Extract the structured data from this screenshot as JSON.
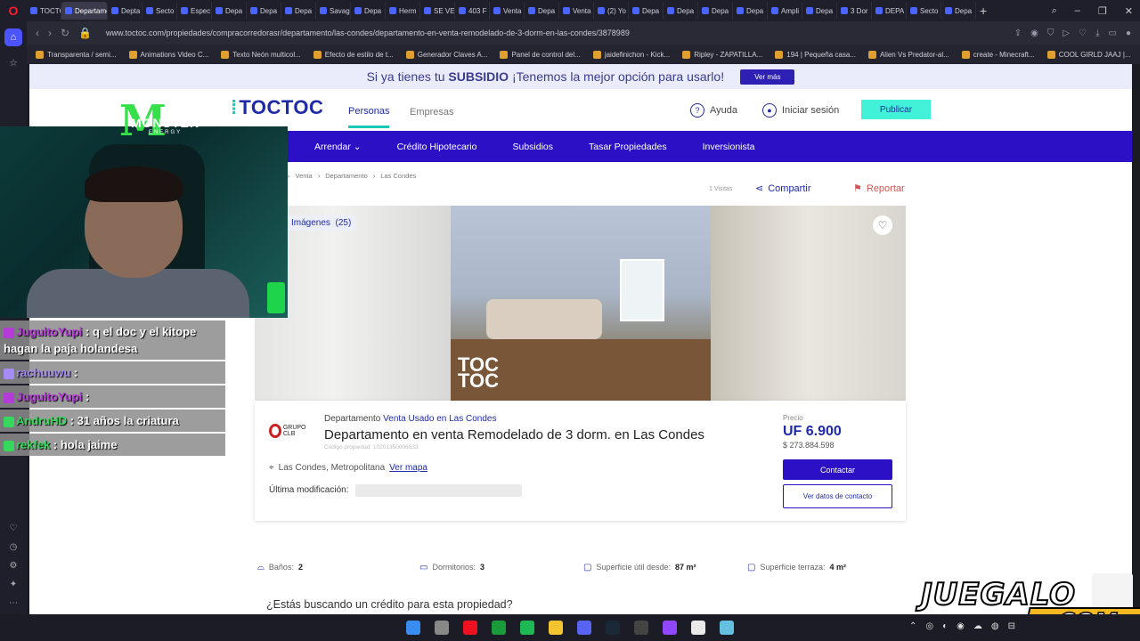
{
  "browser": {
    "tabs": [
      "TOCTC",
      "Departame",
      "Depta",
      "Secto",
      "Espec",
      "Depa",
      "Depa",
      "Depa",
      "Savag",
      "Depa",
      "Herm",
      "SE VE",
      "403 F",
      "Venta",
      "Depa",
      "Venta",
      "(2) Yo",
      "Depa",
      "Depa",
      "Depa",
      "Depa",
      "Ampli",
      "Depa",
      "3 Dor",
      "DEPA",
      "Secto",
      "Depa"
    ],
    "active_tab_index": 1,
    "url": "www.toctoc.com/propiedades/compracorredorasr/departamento/las-condes/departamento-en-venta-remodelado-de-3-dorm-en-las-condes/3878989",
    "bookmarks": [
      "Transparenta / semi...",
      "Animations Video C...",
      "Texto Neón multicol...",
      "Efecto de estilo de t...",
      "Generador Claves A...",
      "Panel de control del...",
      "jaidefinichon - Kick...",
      "Ripley - ZAPATILLA...",
      "194 | Pequeña casa...",
      "Alien Vs Predator-al...",
      "create - Minecraft...",
      "COOL GIRLD JAAJ |..."
    ]
  },
  "banner": {
    "text_before": "Si ya tienes tu",
    "text_bold": "SUBSIDIO",
    "text_after": "¡Tenemos la mejor opción para usarlo!",
    "button": "Ver más"
  },
  "header": {
    "logo_text": "TOCTOC",
    "nav_personas": "Personas",
    "nav_empresas": "Empresas",
    "ayuda": "Ayuda",
    "login": "Iniciar sesión",
    "publicar": "Publicar"
  },
  "menu": [
    "Arrendar",
    "Crédito Hipotecario",
    "Subsidios",
    "Tasar Propiedades",
    "Inversionista"
  ],
  "breadcrumb": [
    "Venta",
    "Departamento",
    "Las Condes"
  ],
  "actions": {
    "visitas": "1 Visitas",
    "compartir": "Compartir",
    "reportar": "Reportar"
  },
  "gallery": {
    "badge": "Imágenes",
    "count": "(25)",
    "watermark_1": "TOC",
    "watermark_2": "TOC"
  },
  "listing": {
    "agency": "GRUPO CLB",
    "type_prefix": "Departamento",
    "type_link": "Venta Usado en Las Condes",
    "title": "Departamento en venta Remodelado de 3 dorm. en Las Condes",
    "code": "Código propiedad: 10201350006533",
    "location": "Las Condes, Metropolitana",
    "map_link": "Ver mapa",
    "last_modified_label": "Última modificación:",
    "price_label": "Precio",
    "price_uf": "UF 6.900",
    "price_clp": "$ 273.884.598",
    "contact_button": "Contactar",
    "contact_data_button": "Ver datos de contacto"
  },
  "features": [
    {
      "label": "Baños:",
      "value": "2"
    },
    {
      "label": "Dormitorios:",
      "value": "3"
    },
    {
      "label": "Superficie útil desde:",
      "value": "87 m²"
    },
    {
      "label": "Superficie terraza:",
      "value": "4 m²"
    }
  ],
  "credit_question": "¿Estás buscando un crédito para esta propiedad?",
  "stream": {
    "chat": [
      {
        "user": "JuguitoYupi",
        "text": ": q el doc y el kitope hagan la paja holandesa",
        "color": "#b53bd8"
      },
      {
        "user": "rachuuwu",
        "text": ":",
        "color": "#a58bf5"
      },
      {
        "user": "JuguitoYupi",
        "text": ":",
        "color": "#b53bd8"
      },
      {
        "user": "AndruHD",
        "text": ": 31 años la criatura",
        "color": "#36d85c"
      },
      {
        "user": "rekfek",
        "text": ": hola jaime",
        "color": "#36d85c"
      }
    ],
    "watermark_top": "JUEGALO",
    "watermark_bottom": ".COM",
    "monster_brand": "MONSTER",
    "monster_sub": "ENERGY"
  },
  "colors": {
    "brand_blue": "#2b10c6",
    "brand_teal": "#41f2d8",
    "accent_red": "#d45555"
  }
}
